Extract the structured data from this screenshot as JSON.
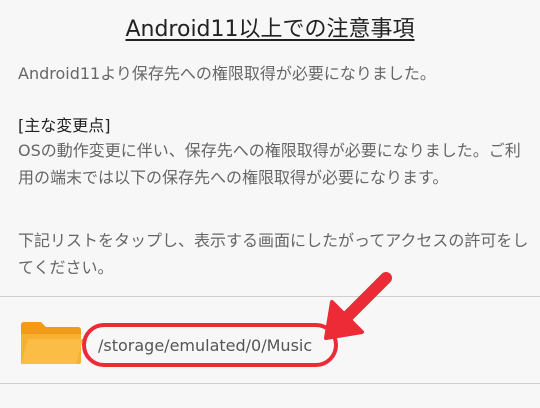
{
  "dialog": {
    "title": "Android11以上での注意事項",
    "intro": "Android11より保存先への権限取得が必要になりました。",
    "section_heading": "[主な変更点]",
    "paragraph1": "OSの動作変更に伴い、保存先への権限取得が必要になりました。ご利用の端末では以下の保存先への権限取得が必要になります。",
    "paragraph2": "下記リストをタップし、表示する画面にしたがってアクセスの許可をしてください。"
  },
  "storage_list": {
    "items": [
      {
        "path": "/storage/emulated/0/Music",
        "icon": "folder-icon"
      }
    ]
  },
  "colors": {
    "annotation": "#ec2b36",
    "folder": "#f7a928",
    "divider": "#cfcfcf"
  }
}
